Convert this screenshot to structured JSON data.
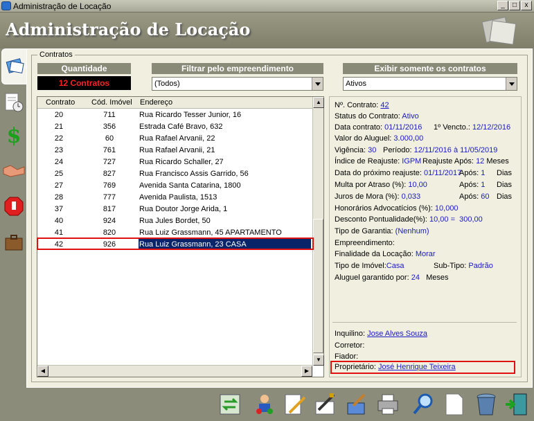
{
  "window": {
    "title": "Administração de Locação",
    "min": "_",
    "max": "□",
    "close": "x"
  },
  "header": {
    "title": "Administração de Locação"
  },
  "group": {
    "label": "Contratos"
  },
  "quantity": {
    "label": "Quantidade",
    "value": "12 Contratos"
  },
  "filter": {
    "label": "Filtrar pelo empreendimento",
    "value": "(Todos)"
  },
  "show": {
    "label": "Exibir somente os contratos",
    "value": "Ativos"
  },
  "grid": {
    "columns": [
      "Contrato",
      "Cód. Imóvel",
      "Endereço"
    ],
    "rows": [
      [
        "20",
        "711",
        "Rua Ricardo Tesser Junior, 16"
      ],
      [
        "21",
        "356",
        "Estrada Café Bravo, 632"
      ],
      [
        "22",
        "60",
        "Rua Rafael Arvanii, 22"
      ],
      [
        "23",
        "761",
        "Rua Rafael Arvanii, 21"
      ],
      [
        "24",
        "727",
        "Rua Ricardo Schaller, 27"
      ],
      [
        "25",
        "827",
        "Rua Francisco Assis Garrido, 56"
      ],
      [
        "27",
        "769",
        "Avenida Santa Catarina, 1800"
      ],
      [
        "28",
        "777",
        "Avenida Paulista, 1513"
      ],
      [
        "37",
        "817",
        "Rua Doutor Jorge Arida, 1"
      ],
      [
        "40",
        "924",
        "Rua Jules Bordet, 50"
      ],
      [
        "41",
        "820",
        "Rua Luiz Grassmann, 45 APARTAMENTO"
      ],
      [
        "42",
        "926",
        "Rua Luiz Grassmann, 23 CASA"
      ]
    ]
  },
  "detail": {
    "contrato_label": "Nº. Contrato:",
    "contrato": "42",
    "status_label": "Status do Contrato:",
    "status": "Ativo",
    "data_label": "Data contrato:",
    "data": "01/11/2016",
    "venc_label": "1º Vencto.:",
    "venc": "12/12/2016",
    "aluguel_label": "Valor do Aluguel:",
    "aluguel": "3.000,00",
    "vig_label": "Vigência:",
    "vig": "30",
    "periodo_label": "Período:",
    "periodo_ini": "12/11/2016",
    "periodo_a": "à",
    "periodo_fim": "11/05/2019",
    "indice_label": "Índice de Reajuste:",
    "indice": "IGPM",
    "reaj_label": "Reajuste Após:",
    "reaj": "12",
    "meses": "Meses",
    "prox_label": "Data do próximo reajuste:",
    "prox": "01/11/2017",
    "apos_label": "Após:",
    "prox_apos": "1",
    "dias": "Dias",
    "multa_label": "Multa por Atraso (%):",
    "multa": "10,00",
    "multa_apos": "1",
    "juros_label": "Juros de Mora (%):",
    "juros": "0,033",
    "juros_apos": "60",
    "hon_label": "Honorários Advocatícios (%):",
    "hon": "10,000",
    "desc_label": "Desconto Pontualidade(%):",
    "desc": "10,00 =",
    "desc_val": "300,00",
    "garantia_label": "Tipo de Garantia:",
    "garantia": "(Nenhum)",
    "emp_label": "Empreendimento:",
    "finalidade_label": "Finalidade da Locação:",
    "finalidade": "Morar",
    "tipo_label": "Tipo de Imóvel:",
    "tipo": "Casa",
    "subtipo_label": "Sub-Tipo:",
    "subtipo": "Padrão",
    "garantido_label": "Aluguel garantido por:",
    "garantido": "24",
    "inquilino_label": "Inquilino:",
    "inquilino": "Jose Alves Souza",
    "corretor_label": "Corretor:",
    "fiador_label": "Fiador:",
    "prop_label": "Proprietário:",
    "prop": "José Henrique Teixeira"
  },
  "nav": [
    "contracts-icon",
    "schedule-icon",
    "money-icon",
    "handshake-icon",
    "stop-icon",
    "briefcase-icon"
  ],
  "toolbar": [
    "refresh-icon",
    "users-icon",
    "edit-icon",
    "sign-icon",
    "clean-icon",
    "print-icon",
    "search-icon",
    "new-document-icon",
    "trash-icon",
    "exit-icon"
  ],
  "colors": {
    "accent": "#0a246a",
    "highlight": "#e01010",
    "link": "#1a1ac8"
  }
}
